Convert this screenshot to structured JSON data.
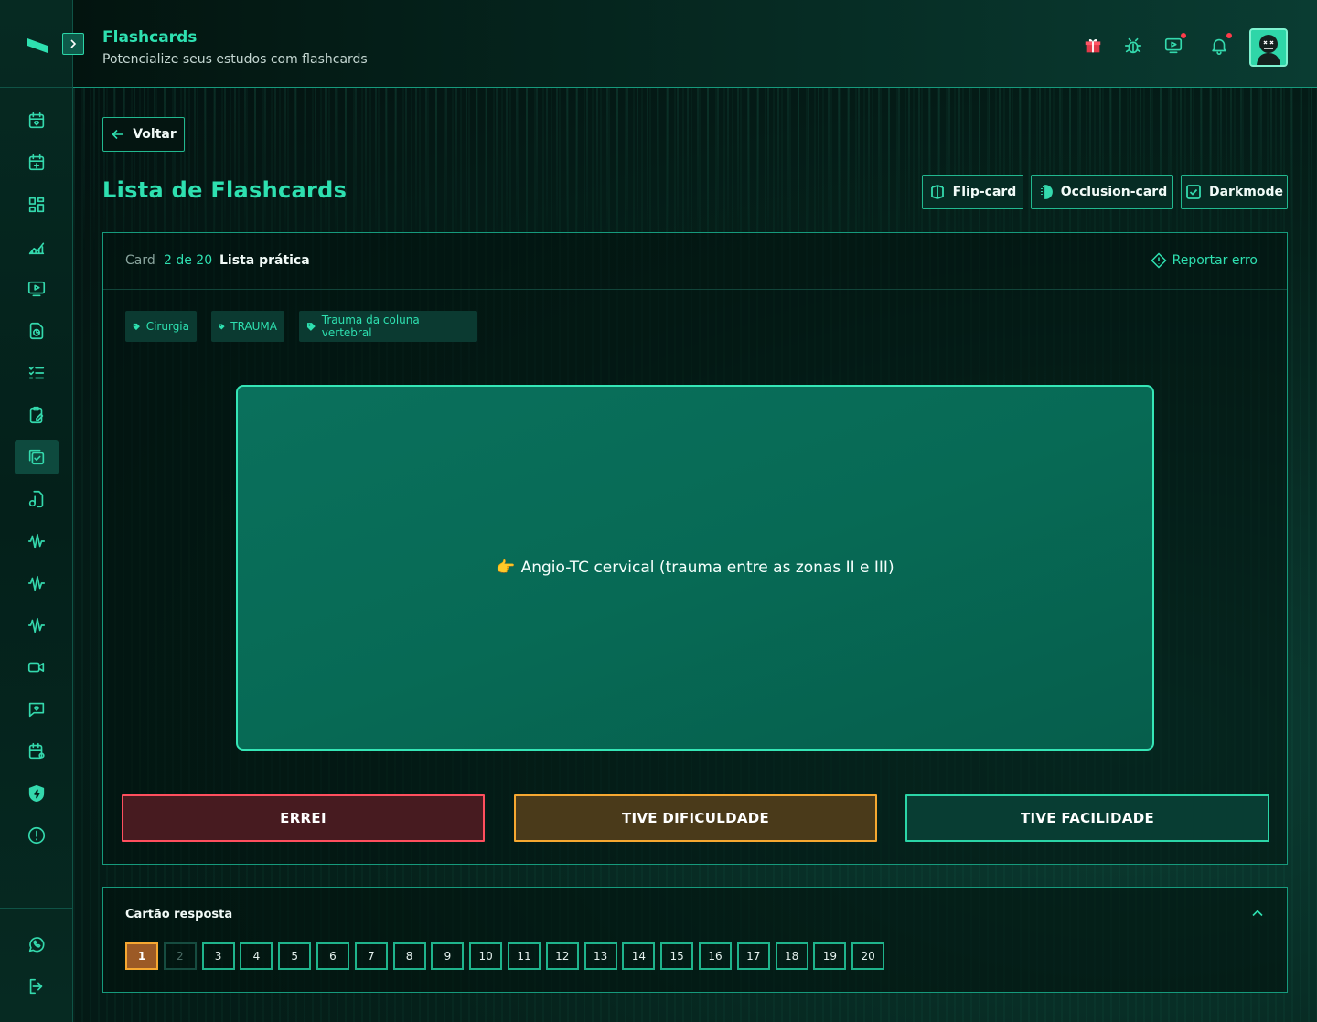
{
  "header": {
    "title": "Flashcards",
    "subtitle": "Potencialize seus estudos com flashcards",
    "icons": [
      "gift-icon",
      "bug-icon",
      "video-icon",
      "bell-icon"
    ],
    "avatar": "avatar"
  },
  "sidebar": {
    "icons": [
      "calendar-heart-icon",
      "calendar-plus-icon",
      "dashboard-icon",
      "chart-icon",
      "monitor-play-icon",
      "file-stats-icon",
      "checklist-icon",
      "clipboard-edit-icon",
      "flashcards-icon",
      "file-audio-icon",
      "waveform-icon",
      "waveform-icon-2",
      "waveform-icon-3",
      "video-camera-icon",
      "chat-heart-icon",
      "calendar-settings-icon",
      "shield-icon",
      "alert-circle-icon"
    ],
    "bottom_icons": [
      "whatsapp-icon",
      "logout-icon"
    ],
    "active_index": 8
  },
  "main": {
    "back_label": "Voltar",
    "list_title": "Lista de Flashcards",
    "modes": [
      "Flip-card",
      "Occlusion-card",
      "Darkmode"
    ]
  },
  "card": {
    "card_label": "Card",
    "count": "2 de 20",
    "list_name": "Lista prática",
    "report_label": "Reportar erro",
    "tags": [
      "Cirurgia",
      "TRAUMA",
      "Trauma da coluna vertebral"
    ],
    "content": "Angio-TC cervical (trauma entre as zonas II e III)",
    "content_emoji": "👉"
  },
  "answers": {
    "wrong": "ERREI",
    "hard": "TIVE DIFICULDADE",
    "easy": "TIVE FACILIDADE"
  },
  "answer_sheet": {
    "title": "Cartão resposta",
    "numbers": [
      "1",
      "2",
      "3",
      "4",
      "5",
      "6",
      "7",
      "8",
      "9",
      "10",
      "11",
      "12",
      "13",
      "14",
      "15",
      "16",
      "17",
      "18",
      "19",
      "20"
    ],
    "current": "1",
    "inactive": "2"
  },
  "colors": {
    "accent": "#2ee0b0",
    "wrong": "#ff4f5e",
    "hard": "#f6a831",
    "easy": "#2bd5a7"
  }
}
